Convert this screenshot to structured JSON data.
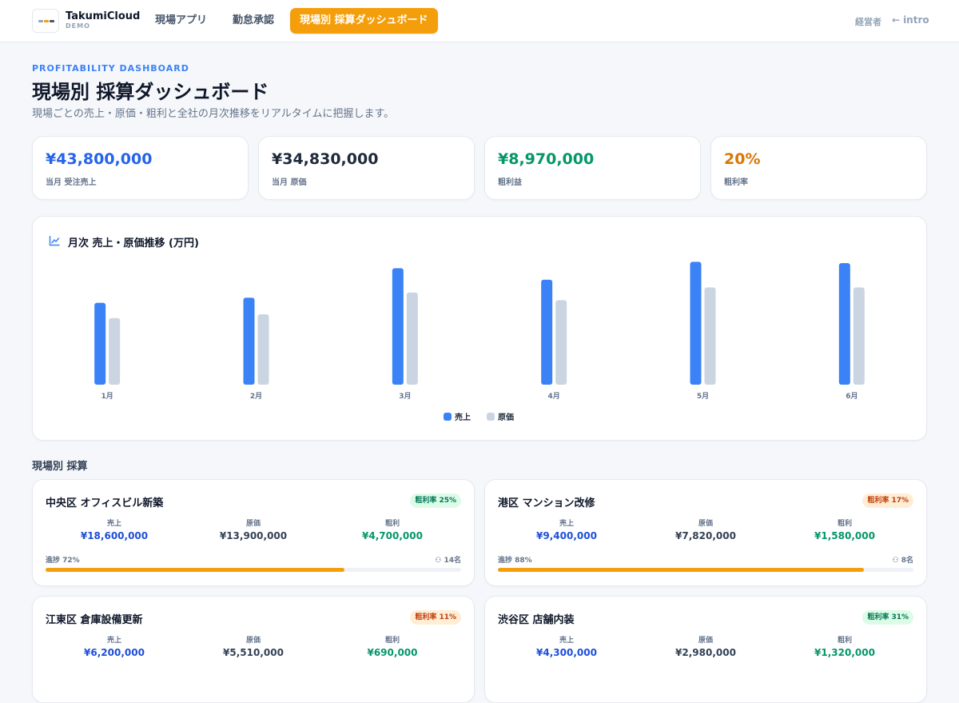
{
  "header": {
    "brand": "TakumiCloud",
    "brand_sub": "DEMO",
    "nav": [
      {
        "label": "現場アプリ"
      },
      {
        "label": "勤怠承認"
      },
      {
        "label": "現場別 採算ダッシュボード",
        "active": true
      }
    ],
    "role": "経営者",
    "back_label": "intro",
    "back_icon": "arrow-left-icon"
  },
  "page": {
    "eyebrow": "PROFITABILITY DASHBOARD",
    "title": "現場別 採算ダッシュボード",
    "subtitle": "現場ごとの売上・原価・粗利と全社の月次推移をリアルタイムに把握します。"
  },
  "kpis": [
    {
      "value": "¥43,800,000",
      "label": "当月 受注売上",
      "color": "#2563eb"
    },
    {
      "value": "¥34,830,000",
      "label": "当月 原価",
      "color": "#1e293b"
    },
    {
      "value": "¥8,970,000",
      "label": "粗利益",
      "color": "#059669"
    },
    {
      "value": "20%",
      "label": "粗利率",
      "color": "#d97706"
    }
  ],
  "chart_title": "月次 売上・原価推移 (万円)",
  "chart_icon": "line-chart-icon",
  "chart_data": {
    "type": "bar",
    "title": "月次 売上・原価推移 (万円)",
    "categories": [
      "1月",
      "2月",
      "3月",
      "4月",
      "5月",
      "6月"
    ],
    "series": [
      {
        "name": "売上",
        "values": [
          3200,
          3400,
          4550,
          4100,
          4800,
          4750
        ],
        "color": "#3b82f6"
      },
      {
        "name": "原価",
        "values": [
          2600,
          2750,
          3600,
          3300,
          3800,
          3800
        ],
        "color": "#cbd5e1"
      }
    ],
    "ylim": [
      0,
      5000
    ],
    "grid": false,
    "legend": "bottom"
  },
  "section_title": "現場別 採算",
  "sites": [
    {
      "name": "中央区 オフィスビル新築",
      "badge": "粗利率 25%",
      "badge_tone": "good",
      "sales_label": "売上",
      "sales": "¥18,600,000",
      "cost_label": "原価",
      "cost": "¥13,900,000",
      "profit_label": "粗利",
      "profit": "¥4,700,000",
      "progress_label": "進捗 72%",
      "progress": 0.72,
      "crew": "14名"
    },
    {
      "name": "港区 マンション改修",
      "badge": "粗利率 17%",
      "badge_tone": "warn",
      "sales_label": "売上",
      "sales": "¥9,400,000",
      "cost_label": "原価",
      "cost": "¥7,820,000",
      "profit_label": "粗利",
      "profit": "¥1,580,000",
      "progress_label": "進捗 88%",
      "progress": 0.88,
      "crew": "8名"
    },
    {
      "name": "江東区 倉庫設備更新",
      "badge": "粗利率 11%",
      "badge_tone": "warn",
      "sales_label": "売上",
      "sales": "¥6,200,000",
      "cost_label": "原価",
      "cost": "¥5,510,000",
      "profit_label": "粗利",
      "profit": "¥690,000"
    },
    {
      "name": "渋谷区 店舗内装",
      "badge": "粗利率 31%",
      "badge_tone": "good",
      "sales_label": "売上",
      "sales": "¥4,300,000",
      "cost_label": "原価",
      "cost": "¥2,980,000",
      "profit_label": "粗利",
      "profit": "¥1,320,000"
    }
  ]
}
